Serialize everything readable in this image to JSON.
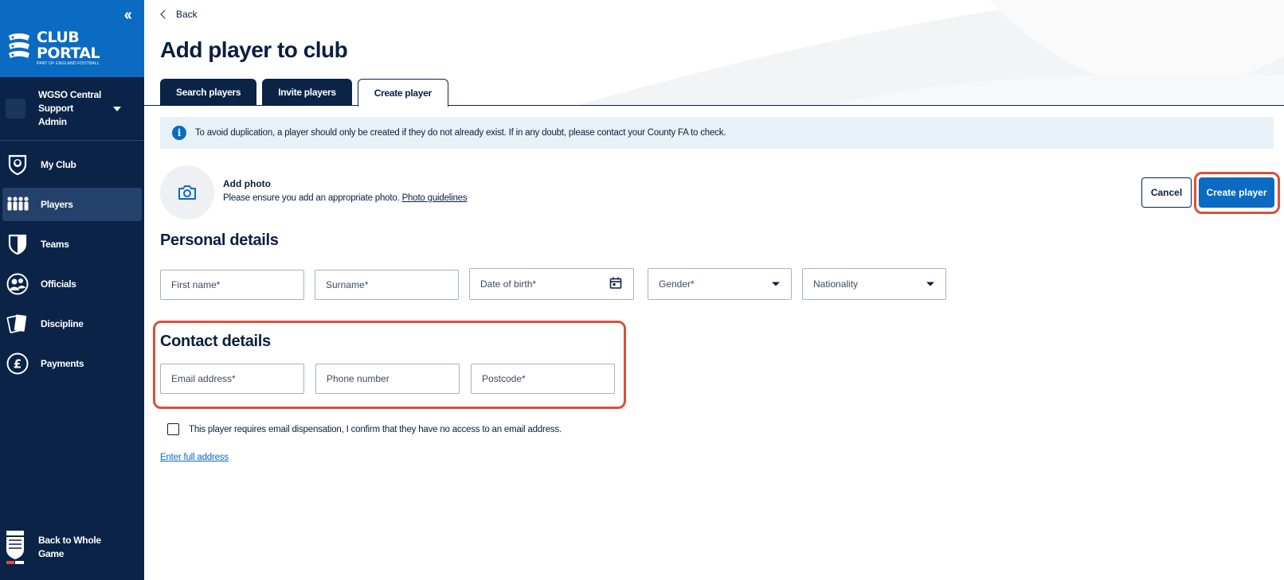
{
  "sidebar": {
    "logo": {
      "title_line1": "CLUB",
      "title_line2": "PORTAL",
      "subtitle": "PART OF ENGLAND FOOTBALL"
    },
    "user": {
      "name": "WGSO Central Support Admin"
    },
    "items": [
      {
        "label": "My Club",
        "icon": "shield-ball-icon",
        "active": false
      },
      {
        "label": "Players",
        "icon": "players-icon",
        "active": true
      },
      {
        "label": "Teams",
        "icon": "shield-icon",
        "active": false
      },
      {
        "label": "Officials",
        "icon": "officials-icon",
        "active": false
      },
      {
        "label": "Discipline",
        "icon": "cards-icon",
        "active": false
      },
      {
        "label": "Payments",
        "icon": "pound-icon",
        "active": false
      }
    ],
    "back_to_whole_game": "Back to Whole Game"
  },
  "header": {
    "back_label": "Back",
    "title": "Add player to club"
  },
  "tabs": [
    {
      "label": "Search players",
      "active": false
    },
    {
      "label": "Invite players",
      "active": false
    },
    {
      "label": "Create player",
      "active": true
    }
  ],
  "info_banner": {
    "text": "To avoid duplication, a player should only be created if they do not already exist. If in any doubt, please contact your County FA to check."
  },
  "photo": {
    "title": "Add photo",
    "description": "Please ensure you add an appropriate photo.",
    "guidelines_link": "Photo guidelines"
  },
  "actions": {
    "cancel_label": "Cancel",
    "create_label": "Create player"
  },
  "personal_details": {
    "title": "Personal details",
    "first_name": "First name*",
    "surname": "Surname*",
    "dob": "Date of birth*",
    "gender": "Gender*",
    "nationality": "Nationality"
  },
  "contact_details": {
    "title": "Contact details",
    "email": "Email address*",
    "phone": "Phone number",
    "postcode": "Postcode*"
  },
  "email_dispensation_label": "This player requires email dispensation, I confirm that they have no access to an email address.",
  "enter_full_address": "Enter full address",
  "colors": {
    "navy": "#0a2347",
    "brand_blue": "#0b6ac2",
    "highlight": "#d9503a",
    "info_bg": "#e8f1f8"
  }
}
